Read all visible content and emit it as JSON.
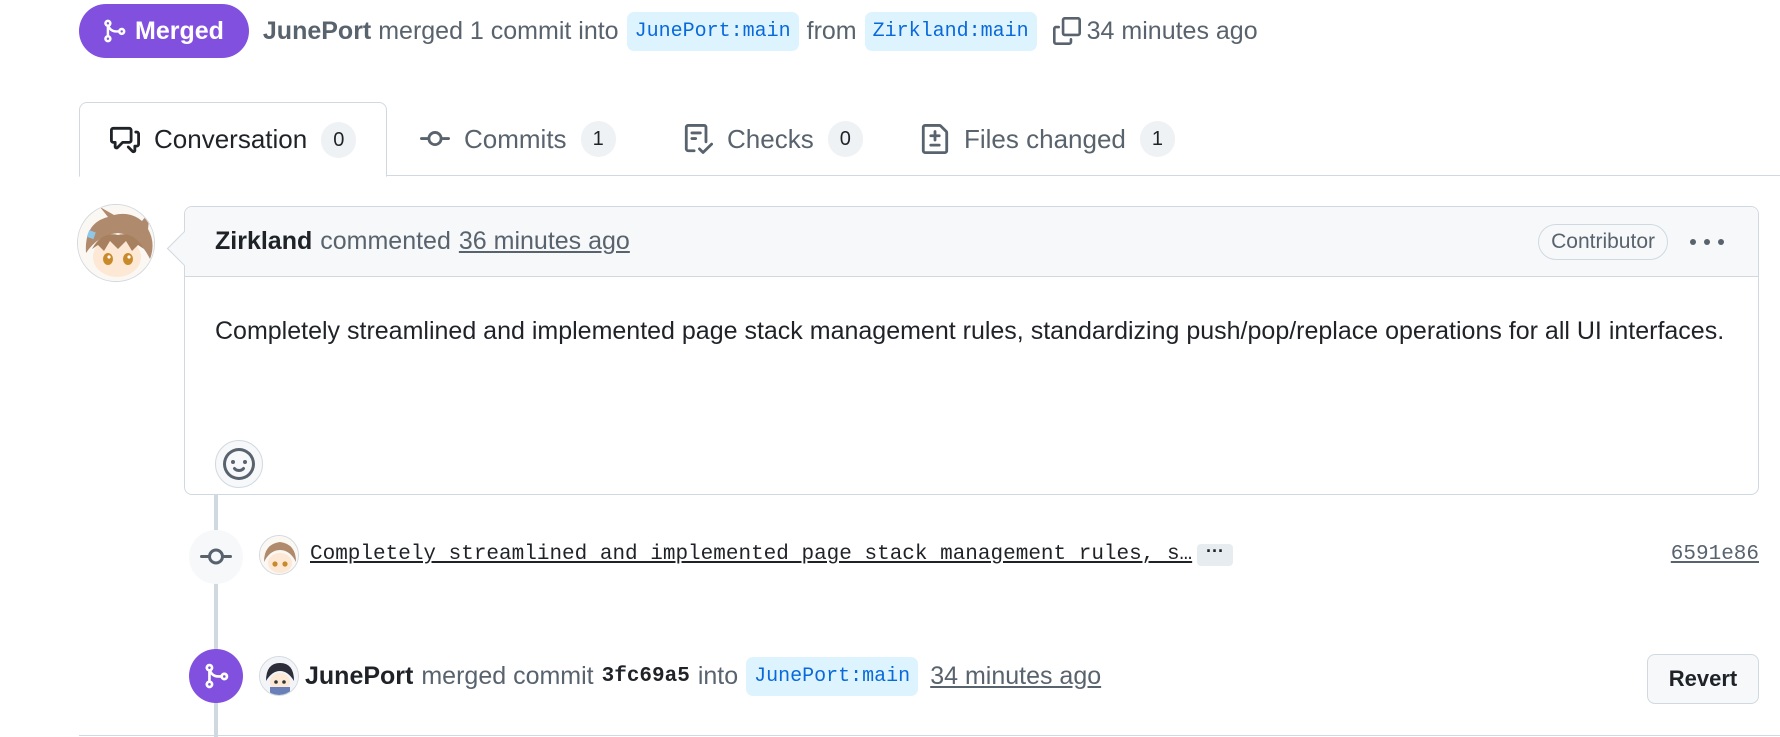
{
  "header": {
    "status_label": "Merged",
    "merger": "JunePort",
    "merged_phrase": "merged 1 commit into",
    "base_branch": "JunePort:main",
    "from_word": "from",
    "head_branch": "Zirkland:main",
    "time": "34 minutes ago"
  },
  "tabs": [
    {
      "label": "Conversation",
      "count": "0",
      "icon": "comment-discussion-icon"
    },
    {
      "label": "Commits",
      "count": "1",
      "icon": "git-commit-icon"
    },
    {
      "label": "Checks",
      "count": "0",
      "icon": "checklist-icon"
    },
    {
      "label": "Files changed",
      "count": "1",
      "icon": "file-diff-icon"
    }
  ],
  "comment": {
    "author": "Zirkland",
    "action": "commented",
    "time": "36 minutes ago",
    "role": "Contributor",
    "body": "Completely streamlined and implemented page stack management rules, standardizing push/pop/replace operations for all UI interfaces."
  },
  "timeline": {
    "commit": {
      "message": "Completely streamlined and implemented page stack management rules, s…",
      "expand_label": "···",
      "sha": "6591e86"
    },
    "merge_event": {
      "author": "JunePort",
      "phrase": "merged commit",
      "commit": "3fc69a5",
      "into_word": "into",
      "branch": "JunePort:main",
      "time": "34 minutes ago",
      "revert_label": "Revert"
    }
  },
  "colors": {
    "merged_purple": "#8250df",
    "branch_bg": "#ddf4ff",
    "branch_fg": "#0969da",
    "border": "#d1d9e0",
    "muted_text": "#59636e"
  }
}
